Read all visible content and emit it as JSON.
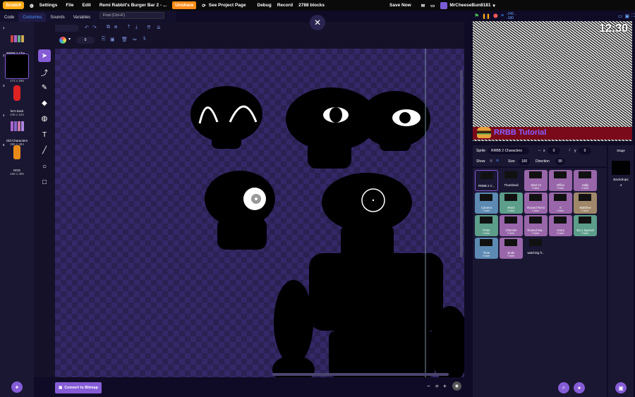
{
  "menubar": {
    "logo": "Scratch",
    "settings": "Settings",
    "file": "File",
    "edit": "Edit",
    "project_title": "Remi Rabbit's Burger Bar 2 - ...",
    "unshare": "Unshare",
    "see_project_page": "See Project Page",
    "debug": "Debug",
    "record": "Record",
    "block_count": "2788 blocks",
    "save_now": "Save Now",
    "username": "MrCheeseBun8181"
  },
  "tabs": [
    {
      "label": "Code"
    },
    {
      "label": "Costumes"
    },
    {
      "label": "Sounds"
    },
    {
      "label": "Variables"
    }
  ],
  "find_placeholder": "Find (Ctrl+F)",
  "costume_name_value": "...",
  "brush_size": "0",
  "costumes": [
    {
      "num": "1",
      "name": "RRBB 2 Cha...",
      "size": "967 x 394"
    },
    {
      "num": "2",
      "name": "",
      "size": "172 x 296"
    },
    {
      "num": "3",
      "name": "he's back",
      "size": "145 x 242"
    },
    {
      "num": "4",
      "name": "Old Characters",
      "size": "386 x 394"
    },
    {
      "num": "5",
      "name": "NOS",
      "size": "166 x 300"
    }
  ],
  "convert_button": "Convert to Bitmap",
  "zoom": {
    "out": "−",
    "reset": "=",
    "in": "+"
  },
  "stage_coords": "-245 , -180",
  "stage_clock": "12:30",
  "stage_banner_text": "RRBB Tutorial",
  "sprite_info": {
    "sprite_label": "Sprite",
    "sprite_name": "RRBB 2 Characters",
    "x_label": "x",
    "x_value": "0",
    "y_label": "y",
    "y_value": "0",
    "show_label": "Show",
    "size_label": "Size",
    "size_value": "100",
    "direction_label": "Direction",
    "direction_value": "90"
  },
  "sprites": [
    {
      "name": "RRBB 2 C...",
      "sub": "",
      "color": "#1a1733",
      "selected": true
    },
    {
      "name": "Thumbnail",
      "sub": "",
      "color": "#1a1733"
    },
    {
      "name": "Start UI",
      "sub": "Folder",
      "color": "#9966aa"
    },
    {
      "name": "Office",
      "sub": "Folder",
      "color": "#9966aa"
    },
    {
      "name": "Sally",
      "sub": "Folder",
      "color": "#9966aa"
    },
    {
      "name": "Camera",
      "sub": "Folder",
      "color": "#5c8ab3"
    },
    {
      "name": "Remi",
      "sub": "Folder",
      "color": "#5c9e8a"
    },
    {
      "name": "Ruined Remi",
      "sub": "Folder",
      "color": "#9966aa"
    },
    {
      "name": "It",
      "sub": "Folder",
      "color": "#9966aa"
    },
    {
      "name": "Matthew",
      "sub": "Folder",
      "color": "#a0876a"
    },
    {
      "name": "Peter",
      "sub": "Folder",
      "color": "#5c9e8a"
    },
    {
      "name": "Chunnie",
      "sub": "Folder",
      "color": "#9966aa"
    },
    {
      "name": "Ruined Ma...",
      "sub": "Folder",
      "color": "#9966aa"
    },
    {
      "name": "Harry",
      "sub": "Folder",
      "color": "#9966aa"
    },
    {
      "name": "No.1 Special",
      "sub": "Folder",
      "color": "#5c9e8a"
    },
    {
      "name": "Time",
      "sub": "Folder",
      "color": "#5c8ab3"
    },
    {
      "name": "Ende",
      "sub": "Folder",
      "color": "#9966aa"
    },
    {
      "name": "watching fr...",
      "sub": "",
      "color": "#1a1733"
    }
  ],
  "stage_panel": {
    "title": "Stage",
    "backdrops_label": "Backdrops",
    "backdrops_count": "4"
  },
  "colors": {
    "accent": "#855cd6",
    "unshare": "#ff8c1a",
    "background": "#0f0b26"
  }
}
